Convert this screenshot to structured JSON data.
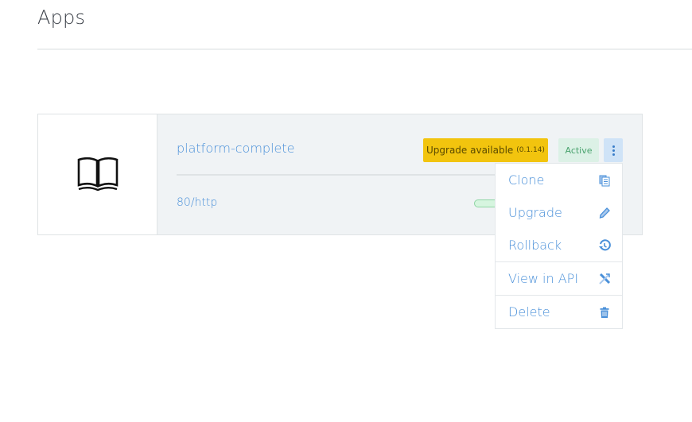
{
  "page": {
    "title": "Apps"
  },
  "app": {
    "name": "platform-complete",
    "endpoint": "80/http",
    "logo_icon": "book-open-icon",
    "badges": {
      "upgrade_label": "Upgrade available",
      "upgrade_version": "(0.1.14)",
      "status": "Active"
    },
    "colors": {
      "accent": "#4a90d9",
      "upgrade_badge": "#f2c40e",
      "active_badge": "#dcf1e6"
    }
  },
  "menu": {
    "items": [
      {
        "label": "Clone",
        "icon": "clone-icon"
      },
      {
        "label": "Upgrade",
        "icon": "pencil-icon"
      },
      {
        "label": "Rollback",
        "icon": "history-icon"
      },
      {
        "label": "View in API",
        "icon": "api-icon"
      },
      {
        "label": "Delete",
        "icon": "trash-icon"
      }
    ]
  }
}
